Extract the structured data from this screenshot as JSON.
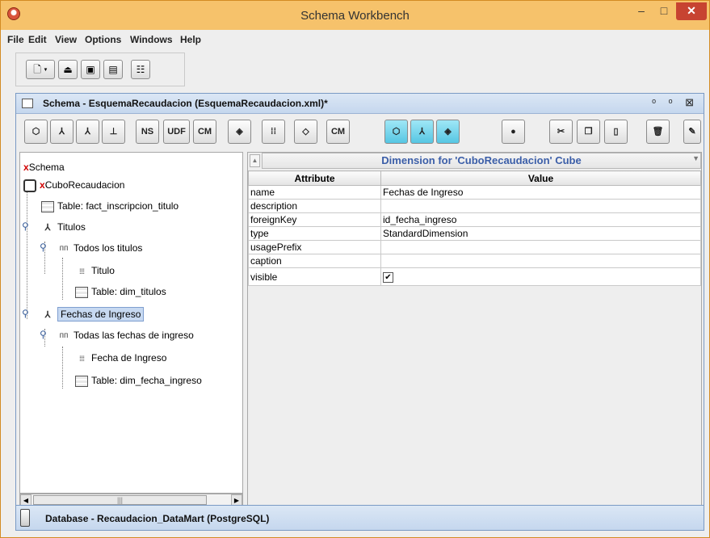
{
  "window": {
    "title": "Schema Workbench",
    "minimize": "–",
    "maximize": "□",
    "close": "✕"
  },
  "menu": [
    {
      "label": "File"
    },
    {
      "label": "Edit"
    },
    {
      "label": "View"
    },
    {
      "label": "Options"
    },
    {
      "label": "Windows"
    },
    {
      "label": "Help"
    }
  ],
  "main_toolbar": {
    "buttons": [
      "new",
      "open",
      "save",
      "save-as",
      "preferences"
    ]
  },
  "schema_frame": {
    "title": "Schema - EsquemaRecaudacion (EsquemaRecaudacion.xml)*",
    "controls": "ᵒ ᵒ ⊠"
  },
  "schema_toolbar": {
    "buttons": [
      {
        "name": "add-cube",
        "glyph": "⬡"
      },
      {
        "name": "add-dimension",
        "glyph": "⅄"
      },
      {
        "name": "add-dimension-usage",
        "glyph": "⅄"
      },
      {
        "name": "add-hierarchy",
        "glyph": "⊥"
      },
      {
        "name": "add-named-set",
        "glyph": "NS"
      },
      {
        "name": "add-user-defined-function",
        "glyph": "UDF"
      },
      {
        "name": "add-calculated-member",
        "glyph": "CM"
      },
      {
        "name": "add-measure",
        "glyph": "◈"
      },
      {
        "name": "add-level",
        "glyph": "⁞⁞"
      },
      {
        "name": "add-property",
        "glyph": "◇"
      },
      {
        "name": "add-calculated-member-2",
        "glyph": "CM"
      },
      {
        "name": "add-virtual-cube",
        "glyph": "⬡"
      },
      {
        "name": "add-virtual-dimension",
        "glyph": "⅄"
      },
      {
        "name": "add-virtual-measure",
        "glyph": "◈"
      },
      {
        "name": "add-role",
        "glyph": "●"
      },
      {
        "name": "cut",
        "glyph": "✂"
      },
      {
        "name": "copy",
        "glyph": "❐"
      },
      {
        "name": "paste",
        "glyph": "▯"
      },
      {
        "name": "delete",
        "glyph": "🗑"
      },
      {
        "name": "edit-mode",
        "glyph": "✎"
      }
    ]
  },
  "tree": {
    "schema": {
      "prefix": "x",
      "label": "Schema"
    },
    "cube": {
      "prefix": "x",
      "label": "CuboRecaudacion"
    },
    "items": [
      {
        "label": "Table: fact_inscripcion_titulo"
      },
      {
        "label": "Titulos"
      },
      {
        "label": "Todos los titulos"
      },
      {
        "label": "Titulo"
      },
      {
        "label": "Table: dim_titulos"
      },
      {
        "label": "Fechas de Ingreso"
      },
      {
        "label": "Todas las fechas de ingreso"
      },
      {
        "label": "Fecha de Ingreso"
      },
      {
        "label": "Table: dim_fecha_ingreso"
      }
    ]
  },
  "properties": {
    "title": "Dimension for 'CuboRecaudacion' Cube",
    "columns": [
      "Attribute",
      "Value"
    ],
    "rows": [
      {
        "attr": "name",
        "value": "Fechas de Ingreso"
      },
      {
        "attr": "description",
        "value": ""
      },
      {
        "attr": "foreignKey",
        "value": "id_fecha_ingreso"
      },
      {
        "attr": "type",
        "value": "StandardDimension"
      },
      {
        "attr": "usagePrefix",
        "value": ""
      },
      {
        "attr": "caption",
        "value": ""
      },
      {
        "attr": "visible",
        "value": "✔"
      }
    ]
  },
  "database": {
    "label": "Database - Recaudacion_DataMart (PostgreSQL)"
  }
}
